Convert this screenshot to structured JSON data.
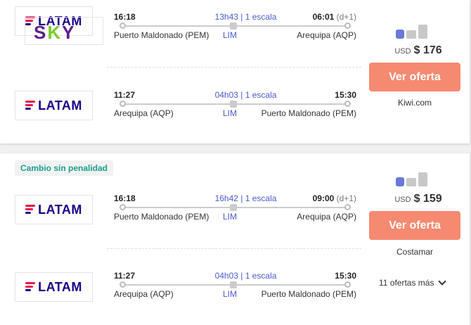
{
  "results": [
    {
      "badge": "",
      "airline_logos": [
        "LATAM",
        "LATAM"
      ],
      "sky_logo": "SKY",
      "segments": [
        {
          "dep_time": "16:18",
          "duration": "13h43 | 1 escala",
          "arr_time": "06:01",
          "arr_offset": "(d+1)",
          "origin": "Puerto Maldonado (PEM)",
          "stop": "LIM",
          "destination": "Arequipa (AQP)"
        },
        {
          "dep_time": "11:27",
          "duration": "04h03 | 1 escala",
          "arr_time": "15:30",
          "arr_offset": "",
          "origin": "Arequipa (AQP)",
          "stop": "LIM",
          "destination": "Puerto Maldonado (PEM)"
        }
      ],
      "currency": "USD",
      "price": "$ 176",
      "cta": "Ver oferta",
      "provider": "Kiwi.com"
    },
    {
      "badge": "Cambio sin penalidad",
      "airline_logos": [
        "LATAM",
        "LATAM"
      ],
      "segments": [
        {
          "dep_time": "16:18",
          "duration": "16h42 | 1 escala",
          "arr_time": "09:00",
          "arr_offset": "(d+1)",
          "origin": "Puerto Maldonado (PEM)",
          "stop": "LIM",
          "destination": "Arequipa (AQP)"
        },
        {
          "dep_time": "11:27",
          "duration": "04h03 | 1 escala",
          "arr_time": "15:30",
          "arr_offset": "",
          "origin": "Arequipa (AQP)",
          "stop": "LIM",
          "destination": "Puerto Maldonado (PEM)"
        }
      ],
      "currency": "USD",
      "price": "$ 159",
      "cta": "Ver oferta",
      "provider": "Costamar",
      "more_offers": "11 ofertas más"
    }
  ],
  "icons": [
    "latam-logo",
    "sky-logo",
    "personal-item-icon",
    "carry-on-icon",
    "checked-bag-icon",
    "chevron-down-icon"
  ],
  "colors": {
    "cta": "#f58a70",
    "accent_blue": "#4a5ad0",
    "badge_text": "#1a9e8f",
    "latam_navy": "#1b0088",
    "latam_red": "#e8114b"
  }
}
